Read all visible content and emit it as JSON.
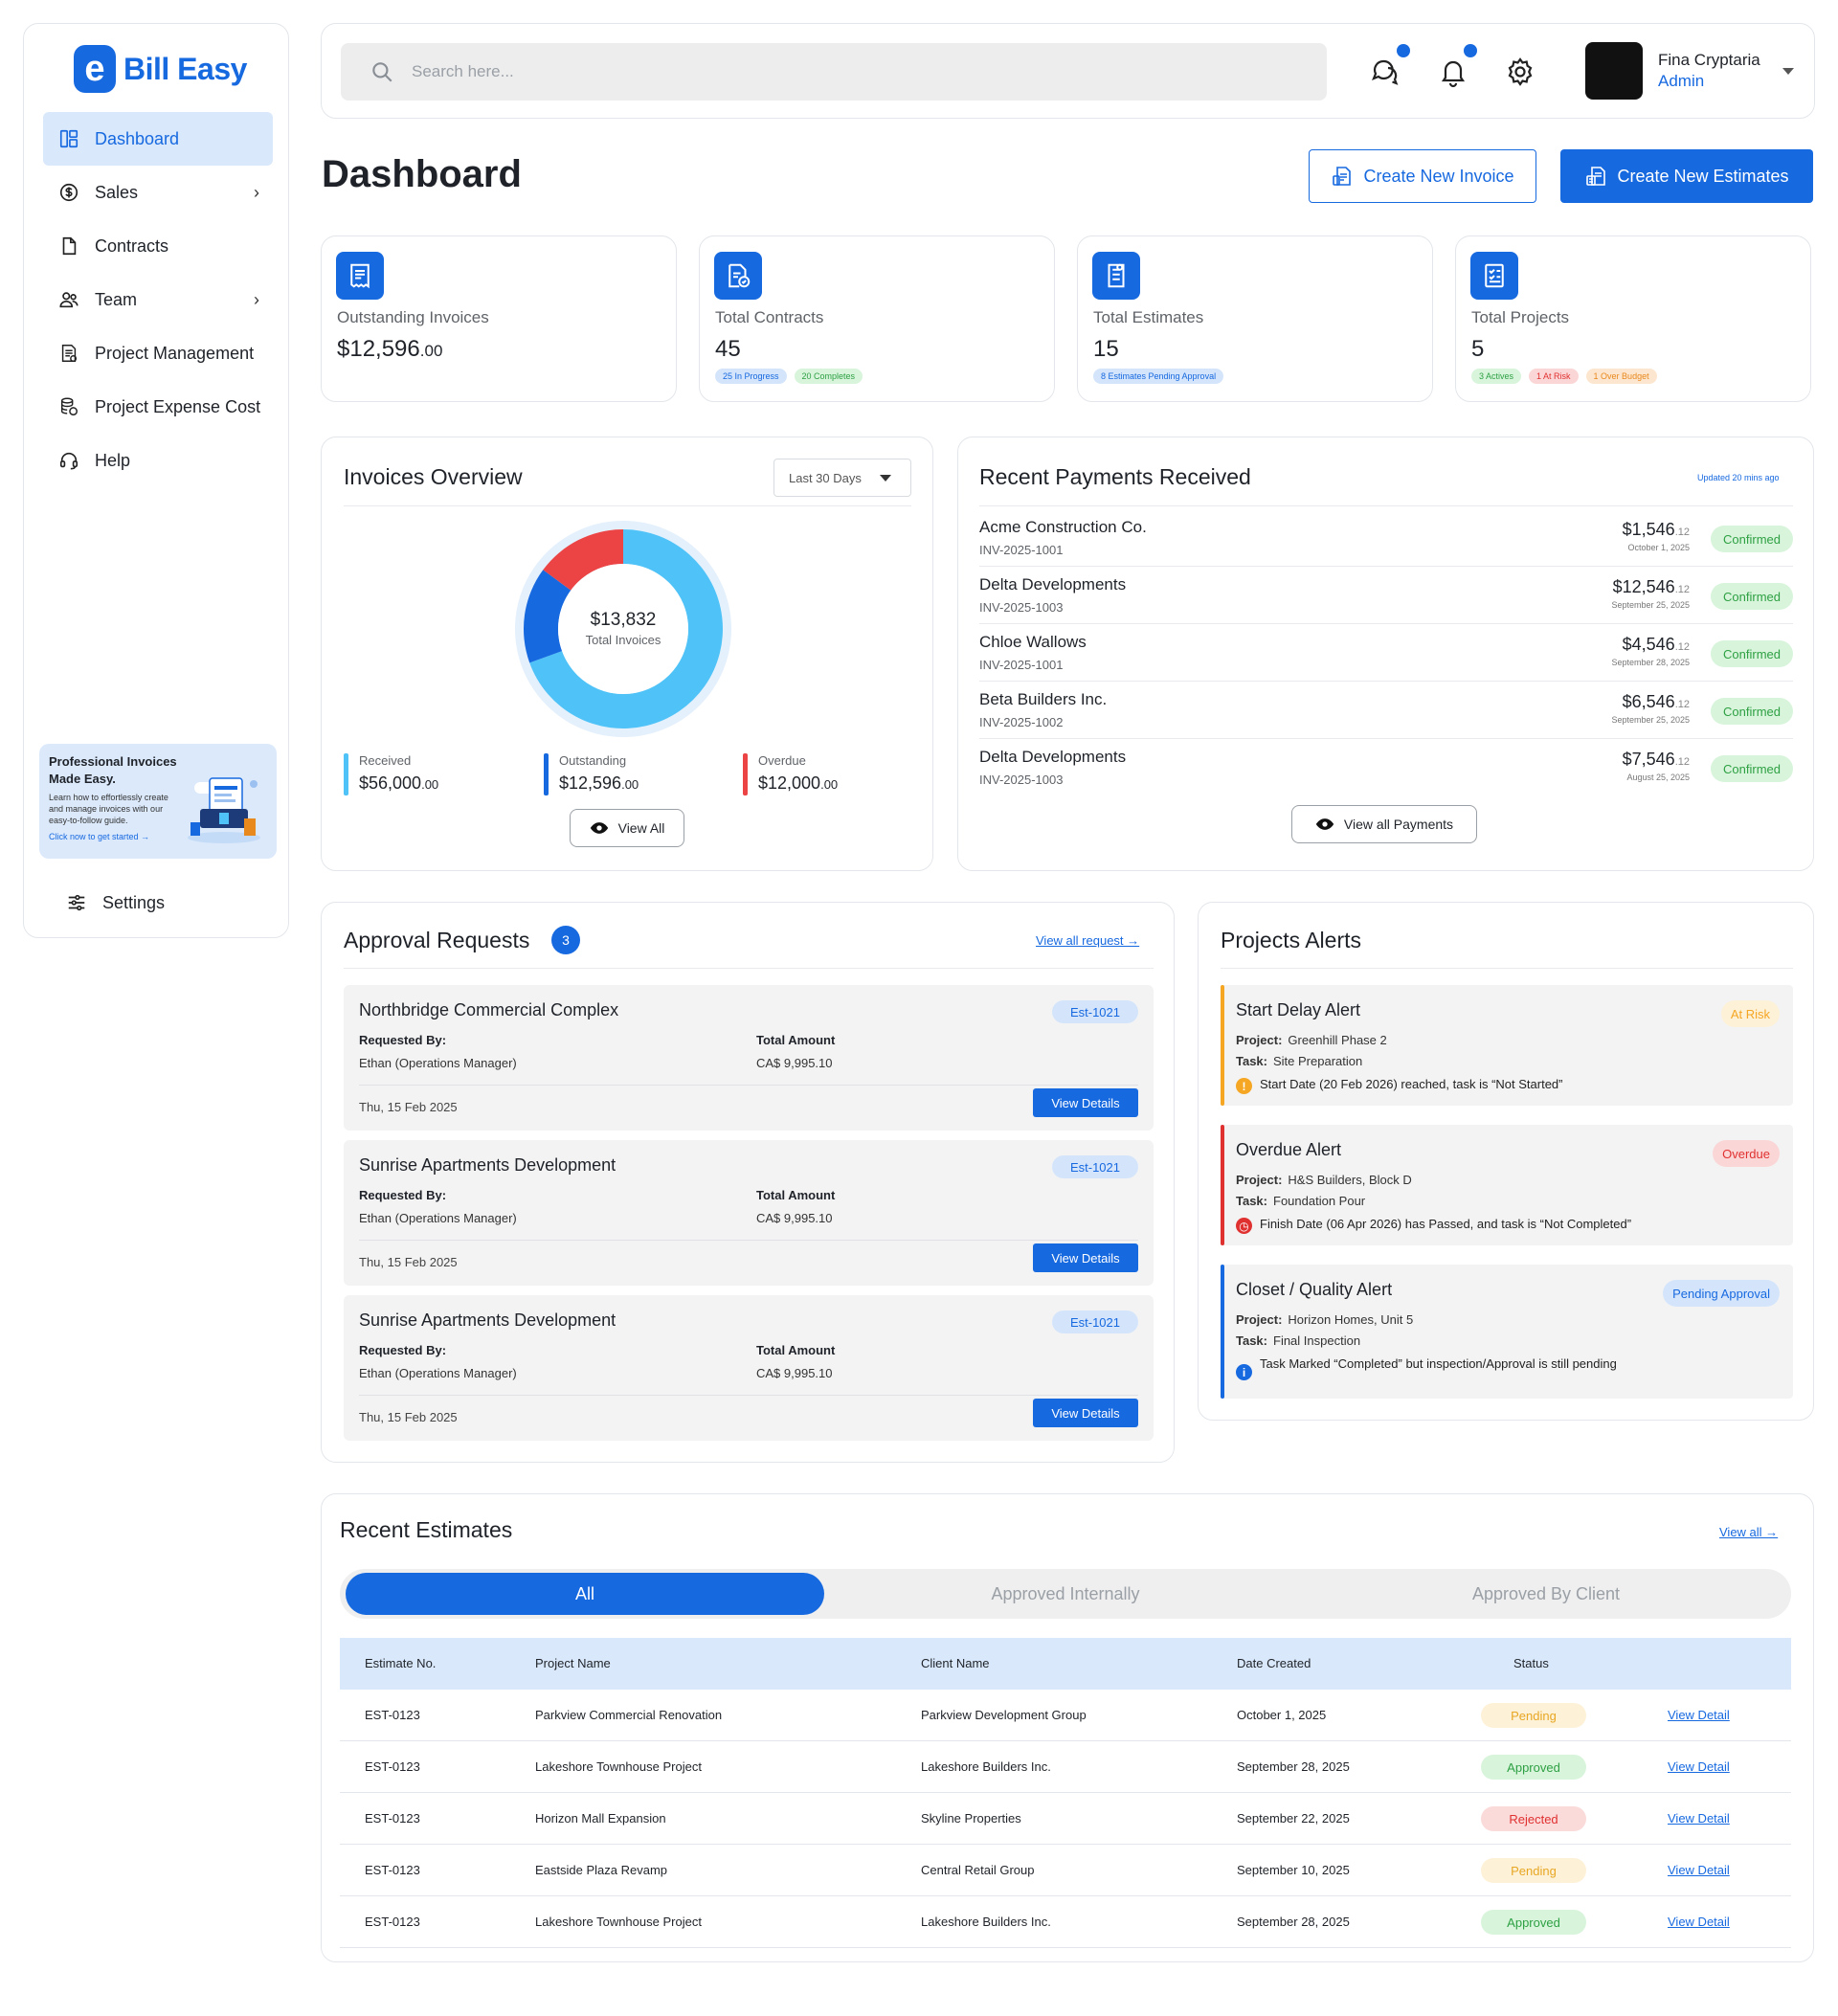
{
  "brand": {
    "name": "Bill Easy",
    "logo_letter": "e"
  },
  "sidebar": {
    "items": [
      {
        "label": "Dashboard",
        "icon": "dashboard-icon",
        "active": true,
        "chevron": false
      },
      {
        "label": "Sales",
        "icon": "dollar-icon",
        "active": false,
        "chevron": true
      },
      {
        "label": "Contracts",
        "icon": "document-icon",
        "active": false,
        "chevron": false
      },
      {
        "label": "Team",
        "icon": "users-icon",
        "active": false,
        "chevron": true
      },
      {
        "label": "Project Management",
        "icon": "project-icon",
        "active": false,
        "chevron": false
      },
      {
        "label": "Project Expense Cost",
        "icon": "coins-icon",
        "active": false,
        "chevron": false
      },
      {
        "label": "Help",
        "icon": "headset-icon",
        "active": false,
        "chevron": false
      }
    ],
    "promo": {
      "title": "Professional Invoices Made Easy.",
      "body": "Learn how to effortlessly create and manage invoices with our easy-to-follow guide.",
      "link": "Click now to get started →"
    },
    "settings_label": "Settings"
  },
  "topbar": {
    "search_placeholder": "Search here...",
    "user_name": "Fina Cryptaria",
    "user_role": "Admin"
  },
  "header": {
    "title": "Dashboard",
    "create_invoice": "Create New Invoice",
    "create_estimates": "Create New Estimates"
  },
  "stats": [
    {
      "label": "Outstanding Invoices",
      "value": "$12,596",
      "cents": ".00",
      "chips": []
    },
    {
      "label": "Total Contracts",
      "value": "45",
      "cents": "",
      "chips": [
        {
          "text": "25 In Progress",
          "tone": "blue"
        },
        {
          "text": "20 Completes",
          "tone": "green"
        }
      ]
    },
    {
      "label": "Total Estimates",
      "value": "15",
      "cents": "",
      "chips": [
        {
          "text": "8 Estimates Pending Approval",
          "tone": "blue"
        }
      ]
    },
    {
      "label": "Total Projects",
      "value": "5",
      "cents": "",
      "chips": [
        {
          "text": "3 Actives",
          "tone": "green"
        },
        {
          "text": "1 At Risk",
          "tone": "red"
        },
        {
          "text": "1 Over Budget",
          "tone": "orange"
        }
      ]
    }
  ],
  "invoices_overview": {
    "title": "Invoices Overview",
    "range": "Last 30 Days",
    "total_value": "$13,832",
    "total_label": "Total Invoices",
    "donut": [
      {
        "name": "Received",
        "value": 56000,
        "color": "#4fc3f7"
      },
      {
        "name": "Outstanding",
        "value": 12596,
        "color": "#1769e0"
      },
      {
        "name": "Overdue",
        "value": 12000,
        "color": "#ec4444"
      }
    ],
    "legend": [
      {
        "label": "Received",
        "value": "$56,000",
        "cents": ".00"
      },
      {
        "label": "Outstanding",
        "value": "$12,596",
        "cents": ".00"
      },
      {
        "label": "Overdue",
        "value": "$12,000",
        "cents": ".00"
      }
    ],
    "view_all": "View All"
  },
  "payments": {
    "title": "Recent Payments Received",
    "updated": "Updated 20 mins ago",
    "rows": [
      {
        "name": "Acme Construction Co.",
        "invoice": "INV-2025-1001",
        "amount": "$1,546",
        "cents": ".12",
        "date": "October 1, 2025",
        "status": "Confirmed"
      },
      {
        "name": "Delta Developments",
        "invoice": "INV-2025-1003",
        "amount": "$12,546",
        "cents": ".12",
        "date": "September 25, 2025",
        "status": "Confirmed"
      },
      {
        "name": "Chloe Wallows",
        "invoice": "INV-2025-1001",
        "amount": "$4,546",
        "cents": ".12",
        "date": "September 28, 2025",
        "status": "Confirmed"
      },
      {
        "name": "Beta Builders Inc.",
        "invoice": "INV-2025-1002",
        "amount": "$6,546",
        "cents": ".12",
        "date": "September 25, 2025",
        "status": "Confirmed"
      },
      {
        "name": "Delta Developments",
        "invoice": "INV-2025-1003",
        "amount": "$7,546",
        "cents": ".12",
        "date": "August 25, 2025",
        "status": "Confirmed"
      }
    ],
    "view_all": "View all Payments"
  },
  "approvals": {
    "title": "Approval Requests",
    "count": "3",
    "view_all": "View all  request →",
    "requested_by_label": "Requested By:",
    "total_label": "Total Amount",
    "view_details": "View Details",
    "items": [
      {
        "title": "Northbridge Commercial Complex",
        "est": "Est-1021",
        "requester": "Ethan (Operations Manager)",
        "amount": "CA$ 9,995.10",
        "date": "Thu, 15 Feb 2025"
      },
      {
        "title": "Sunrise Apartments Development",
        "est": "Est-1021",
        "requester": "Ethan (Operations Manager)",
        "amount": "CA$ 9,995.10",
        "date": "Thu, 15 Feb 2025"
      },
      {
        "title": "Sunrise Apartments Development",
        "est": "Est-1021",
        "requester": "Ethan (Operations Manager)",
        "amount": "CA$ 9,995.10",
        "date": "Thu, 15 Feb 2025"
      }
    ]
  },
  "alerts": {
    "title": "Projects Alerts",
    "project_label": "Project:",
    "task_label": "Task:",
    "items": [
      {
        "title": "Start Delay Alert",
        "badge": "At Risk",
        "tone": "#f5a623",
        "badge_bg": "#fdf1d8",
        "project": "Greenhill Phase 2",
        "task": "Site Preparation",
        "message": "Start Date (20 Feb 2026) reached, task is “Not Started”",
        "icon": "!"
      },
      {
        "title": "Overdue Alert",
        "badge": "Overdue",
        "tone": "#e03131",
        "badge_bg": "#fbd6d6",
        "project": "H&S Builders, Block D",
        "task": "Foundation Pour",
        "message": "Finish Date (06 Apr 2026) has Passed, and task is “Not Completed”",
        "icon": "◷"
      },
      {
        "title": "Closet / Quality Alert",
        "badge": "Pending Approval",
        "tone": "#1769e0",
        "badge_bg": "#d4e5fb",
        "project": "Horizon Homes, Unit 5",
        "task": "Final Inspection",
        "message": "Task Marked “Completed” but inspection/Approval is still pending",
        "icon": "i"
      }
    ]
  },
  "estimates": {
    "title": "Recent Estimates",
    "view_all": "View all →",
    "tabs": [
      "All",
      "Approved Internally",
      "Approved By Client"
    ],
    "columns": [
      "Estimate No.",
      "Project Name",
      "Client Name",
      "Date Created",
      "Status"
    ],
    "view_detail": "View Detail",
    "rows": [
      {
        "no": "EST-0123",
        "project": "Parkview Commercial Renovation",
        "client": "Parkview Development Group",
        "date": "October 1, 2025",
        "status": "Pending"
      },
      {
        "no": "EST-0123",
        "project": "Lakeshore Townhouse Project",
        "client": "Lakeshore Builders Inc.",
        "date": "September 28, 2025",
        "status": "Approved"
      },
      {
        "no": "EST-0123",
        "project": "Horizon Mall Expansion",
        "client": "Skyline Properties",
        "date": "September 22, 2025",
        "status": "Rejected"
      },
      {
        "no": "EST-0123",
        "project": "Eastside Plaza Revamp",
        "client": "Central Retail Group",
        "date": "September 10, 2025",
        "status": "Pending"
      },
      {
        "no": "EST-0123",
        "project": "Lakeshore Townhouse Project",
        "client": "Lakeshore Builders Inc.",
        "date": "September 28, 2025",
        "status": "Approved"
      }
    ]
  }
}
